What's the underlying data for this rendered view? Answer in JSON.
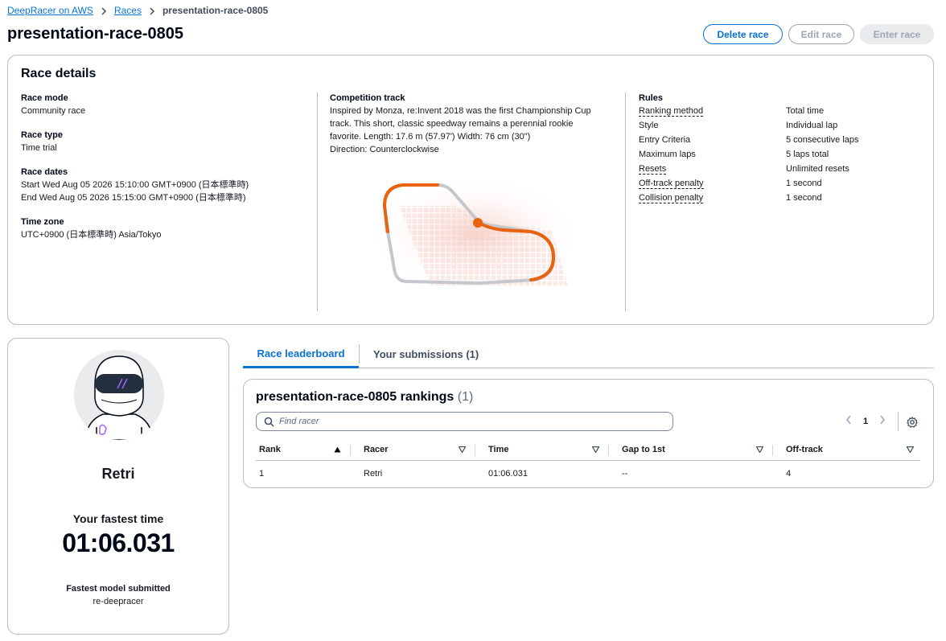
{
  "breadcrumb": {
    "home": "DeepRacer on AWS",
    "races": "Races",
    "current": "presentation-race-0805"
  },
  "page": {
    "title": "presentation-race-0805",
    "delete_label": "Delete race",
    "edit_label": "Edit race",
    "enter_label": "Enter race"
  },
  "details": {
    "title": "Race details",
    "race_mode_label": "Race mode",
    "race_mode": "Community race",
    "race_type_label": "Race type",
    "race_type": "Time trial",
    "race_dates_label": "Race dates",
    "start": "Start Wed Aug 05 2026 15:10:00 GMT+0900 (日本標準時)",
    "end": "End Wed Aug 05 2026 15:15:00 GMT+0900 (日本標準時)",
    "time_zone_label": "Time zone",
    "time_zone": "UTC+0900 (日本標準時) Asia/Tokyo",
    "track_label": "Competition track",
    "track_desc": "Inspired by Monza, re:Invent 2018 was the first Championship Cup track. This short, classic speedway remains a perennial rookie favorite. Length: 17.6 m (57.97') Width: 76 cm (30\")",
    "track_direction": "Direction: Counterclockwise",
    "rules_label": "Rules",
    "rules": [
      {
        "key": "Ranking method",
        "value": "Total time",
        "dashed": true
      },
      {
        "key": "Style",
        "value": "Individual lap",
        "dashed": false
      },
      {
        "key": "Entry Criteria",
        "value": "5 consecutive laps",
        "dashed": false
      },
      {
        "key": "Maximum laps",
        "value": "5 laps total",
        "dashed": false
      },
      {
        "key": "Resets",
        "value": "Unlimited resets",
        "dashed": true
      },
      {
        "key": "Off-track penalty",
        "value": "1 second",
        "dashed": true
      },
      {
        "key": "Collision penalty",
        "value": "1 second",
        "dashed": true
      }
    ]
  },
  "profile": {
    "name": "Retri",
    "fastest_label": "Your fastest time",
    "fastest_time": "01:06.031",
    "model_label": "Fastest model submitted",
    "model": "re-deepracer"
  },
  "tabs": {
    "leaderboard": "Race leaderboard",
    "submissions": "Your submissions (1)"
  },
  "leaderboard": {
    "title": "presentation-race-0805 rankings",
    "count": "(1)",
    "search_placeholder": "Find racer",
    "page": "1",
    "columns": [
      "Rank",
      "Racer",
      "Time",
      "Gap to 1st",
      "Off-track"
    ],
    "rows": [
      [
        "1",
        "Retri",
        "01:06.031",
        "--",
        "4"
      ]
    ]
  },
  "colors": {
    "accent": "#0972d3",
    "track_orange": "#e8620f"
  }
}
